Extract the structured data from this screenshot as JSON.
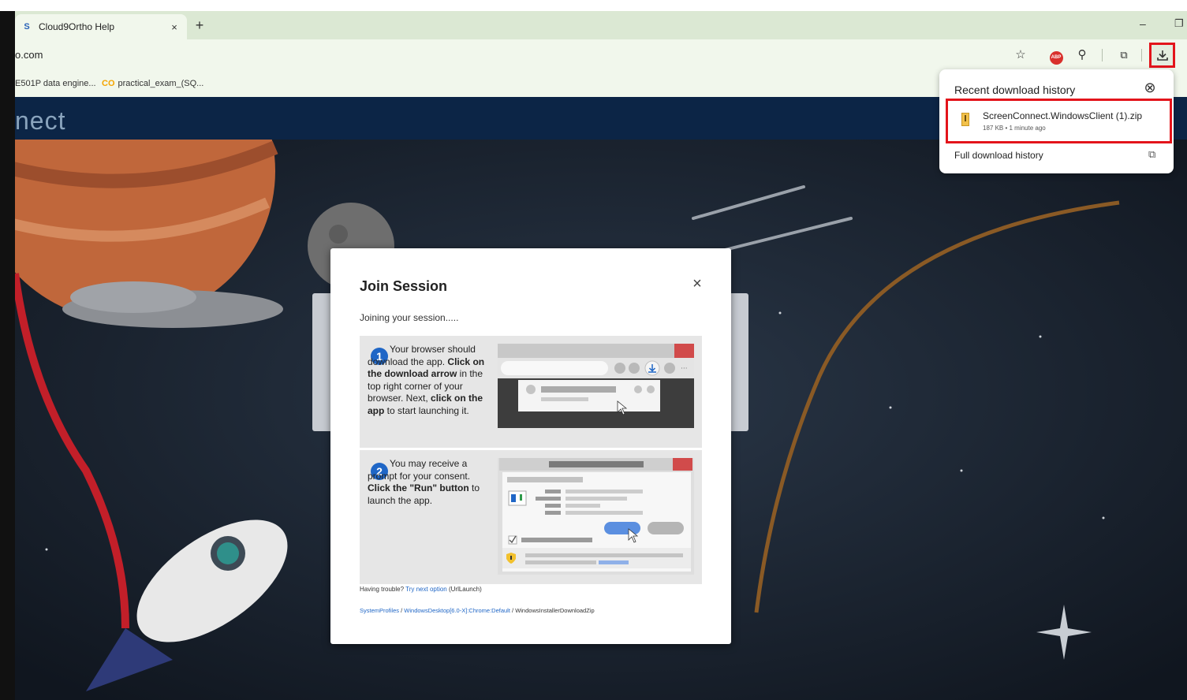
{
  "browser": {
    "tab_title": "Cloud9Ortho Help",
    "tab_favicon": "S",
    "tab_close": "×",
    "new_tab": "+",
    "url_text": "o.com",
    "window_minimize": "–",
    "window_restore": "❐",
    "toolbar": {
      "star": "☆",
      "abp": "ABP",
      "extensions": "⚲",
      "sidepanel": "⧉",
      "download": "⤓"
    },
    "bookmarks": [
      {
        "label": "E501P data engine..."
      },
      {
        "prefix": "CO",
        "label": "practical_exam_(SQ..."
      }
    ]
  },
  "page": {
    "brand": "nect"
  },
  "modal": {
    "title": "Join Session",
    "close": "×",
    "subtitle": "Joining your session.....",
    "step1": {
      "number": "1",
      "text_a": "Your browser should download the app. ",
      "bold_a": "Click on the download arrow",
      "text_b": " in the top right corner of your browser. Next, ",
      "bold_b": "click on the app",
      "text_c": " to start launching it."
    },
    "step2": {
      "number": "2",
      "text_a": "You may receive a prompt for your consent. ",
      "bold_a": "Click the \"Run\" button",
      "text_b": " to launch the app."
    },
    "trouble_prefix": "Having trouble? ",
    "trouble_link": "Try next option",
    "trouble_suffix": " (UrlLaunch)",
    "path_link1": "SystemProfiles",
    "path_sep1": " / ",
    "path_link2": "WindowsDesktop[6.0-X]:Chrome:Default",
    "path_sep2": " / ",
    "path_tail": "WindowsInstallerDownloadZip"
  },
  "download_panel": {
    "title": "Recent download history",
    "close": "⊗",
    "item_name": "ScreenConnect.WindowsClient (1).zip",
    "item_meta": "187 KB • 1 minute ago",
    "full_history": "Full download history",
    "external": "⧉"
  }
}
